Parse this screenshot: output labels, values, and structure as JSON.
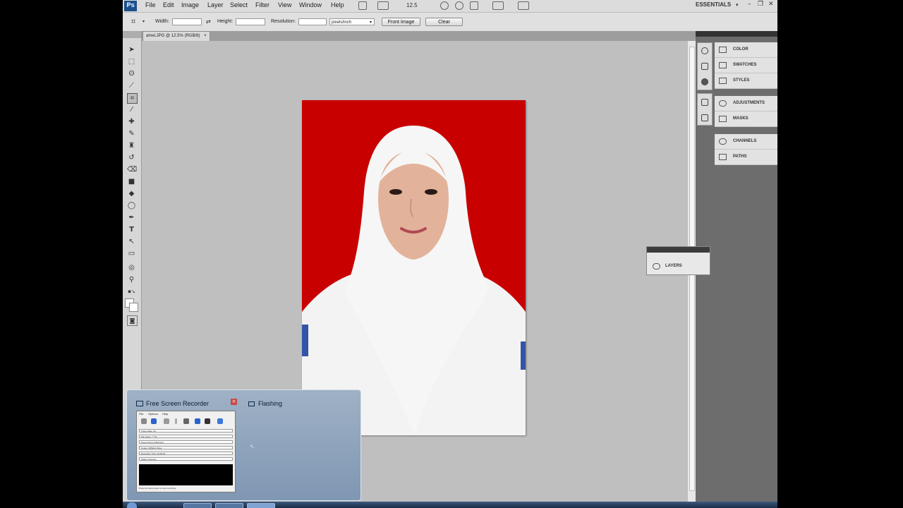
{
  "menubar": {
    "logo": "Ps",
    "items": [
      "File",
      "Edit",
      "Image",
      "Layer",
      "Select",
      "Filter",
      "View",
      "Window",
      "Help"
    ],
    "zoom": "12.5",
    "workspace": "ESSENTIALS",
    "win_min": "–",
    "win_max": "❐",
    "win_close": "✕"
  },
  "options": {
    "width_label": "Width:",
    "width_value": "",
    "swap": "⇄",
    "height_label": "Height:",
    "height_value": "",
    "resolution_label": "Resolution:",
    "resolution_value": "",
    "unit": "pixels/inch",
    "front_image": "Front Image",
    "clear": "Clear"
  },
  "document": {
    "tab": "amel.JPG @ 12.5% (RGB/8)",
    "tab_close": "×"
  },
  "panels": {
    "group1": [
      "COLOR",
      "SWATCHES",
      "STYLES"
    ],
    "group2": [
      "ADJUSTMENTS",
      "MASKS"
    ],
    "group3": [
      "CHANNELS",
      "PATHS"
    ],
    "floating": "LAYERS"
  },
  "recorder": {
    "title": "Free Screen Recorder",
    "close": "×",
    "preview_title": "Flashing",
    "menu": [
      "File",
      "Options",
      "Help"
    ],
    "fields": [
      "Frame Rate: 30",
      "File Name: ***.flv",
      "Screen Area: Fullscreen",
      "Codec: MPEG4 Video",
      "Recording Time: 00:00:00",
      "Status: Stopped"
    ],
    "hint": "Press the Stop button to stop recording"
  },
  "colors": {
    "photo_background": "#c90000",
    "accent": "#1c4f8c"
  }
}
